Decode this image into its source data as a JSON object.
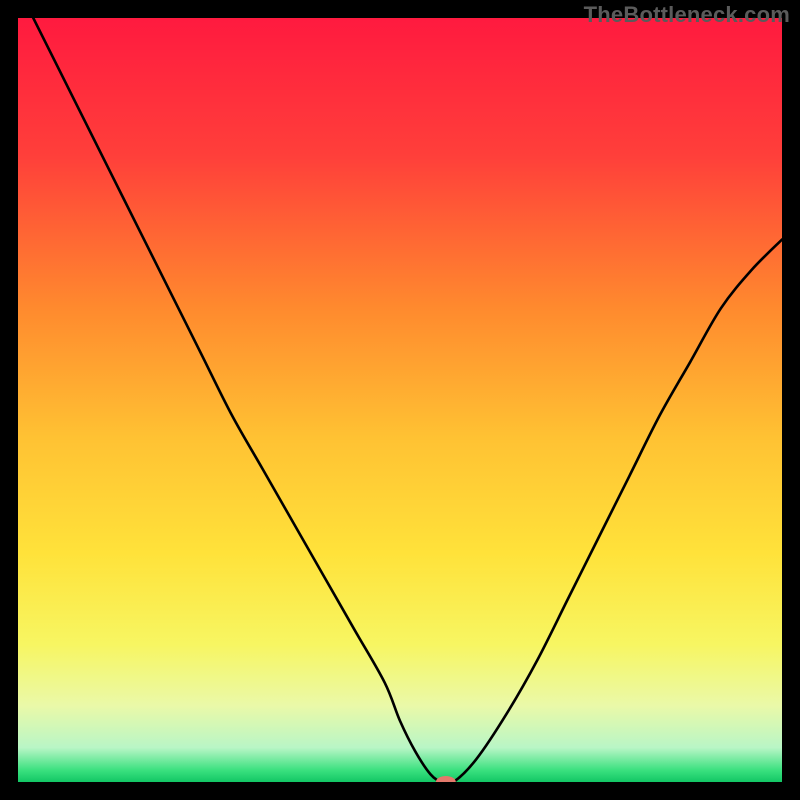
{
  "watermark": {
    "text": "TheBottleneck.com"
  },
  "chart_data": {
    "type": "line",
    "title": "",
    "xlabel": "",
    "ylabel": "",
    "xlim": [
      0,
      100
    ],
    "ylim": [
      0,
      100
    ],
    "grid": false,
    "legend": false,
    "background_gradient": {
      "stops": [
        {
          "pos": 0.0,
          "color": "#ff1a3f"
        },
        {
          "pos": 0.18,
          "color": "#ff3f3a"
        },
        {
          "pos": 0.38,
          "color": "#ff8a2e"
        },
        {
          "pos": 0.55,
          "color": "#ffc233"
        },
        {
          "pos": 0.7,
          "color": "#ffe23a"
        },
        {
          "pos": 0.82,
          "color": "#f7f662"
        },
        {
          "pos": 0.9,
          "color": "#eaf9a8"
        },
        {
          "pos": 0.955,
          "color": "#b9f6c6"
        },
        {
          "pos": 0.985,
          "color": "#39e07e"
        },
        {
          "pos": 1.0,
          "color": "#12c765"
        }
      ]
    },
    "series": [
      {
        "name": "bottleneck-curve",
        "color": "#000000",
        "width": 2.4,
        "x": [
          0,
          4,
          8,
          12,
          16,
          20,
          24,
          28,
          32,
          36,
          40,
          44,
          48,
          50,
          52,
          54,
          55.5,
          57,
          60,
          64,
          68,
          72,
          76,
          80,
          84,
          88,
          92,
          96,
          100
        ],
        "values": [
          104,
          96,
          88,
          80,
          72,
          64,
          56,
          48,
          41,
          34,
          27,
          20,
          13,
          8,
          4,
          1,
          0,
          0,
          3,
          9,
          16,
          24,
          32,
          40,
          48,
          55,
          62,
          67,
          71
        ]
      }
    ],
    "marker": {
      "name": "optimal-point",
      "x": 56,
      "y": 0,
      "color": "#e3796b",
      "rx": 10,
      "ry": 6
    }
  }
}
